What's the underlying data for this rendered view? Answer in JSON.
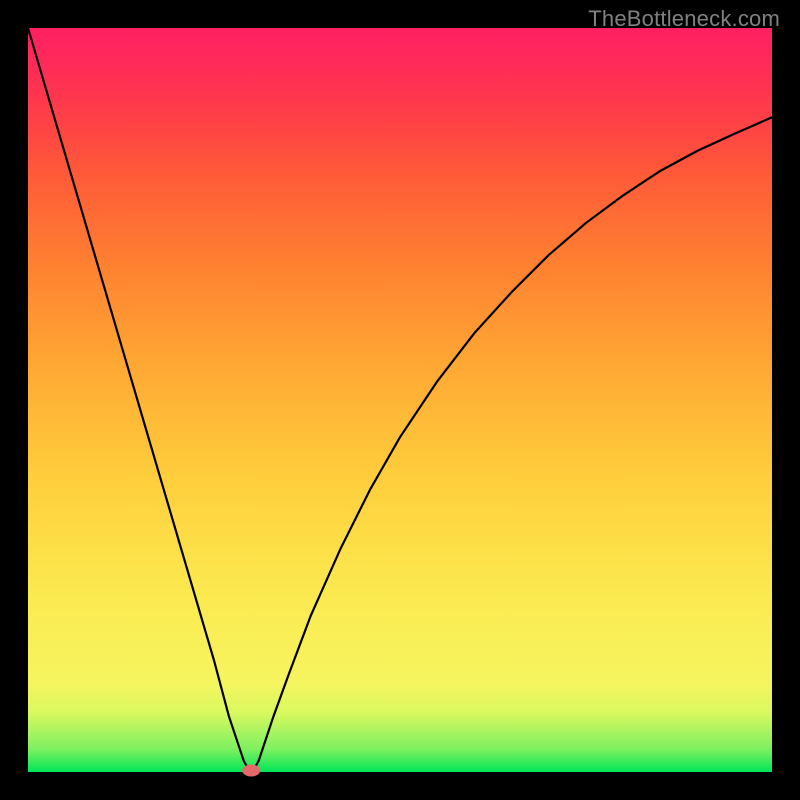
{
  "watermark": "TheBottleneck.com",
  "chart_data": {
    "type": "line",
    "title": "",
    "xlabel": "",
    "ylabel": "",
    "xlim": [
      0,
      100
    ],
    "ylim": [
      0,
      100
    ],
    "grid": false,
    "x": [
      0,
      5,
      10,
      15,
      20,
      25,
      27,
      29,
      29.5,
      30,
      30.5,
      31,
      33,
      35,
      38,
      42,
      46,
      50,
      55,
      60,
      65,
      70,
      75,
      80,
      85,
      90,
      95,
      100
    ],
    "values": [
      100,
      83,
      66,
      49,
      32,
      15,
      7.5,
      1.5,
      0.6,
      0.2,
      0.6,
      1.5,
      7.5,
      13,
      21,
      30,
      38,
      45,
      52.5,
      59,
      64.5,
      69.5,
      73.8,
      77.5,
      80.8,
      83.5,
      85.8,
      88
    ],
    "marker_point": {
      "x": 30,
      "y": 0.2
    }
  }
}
